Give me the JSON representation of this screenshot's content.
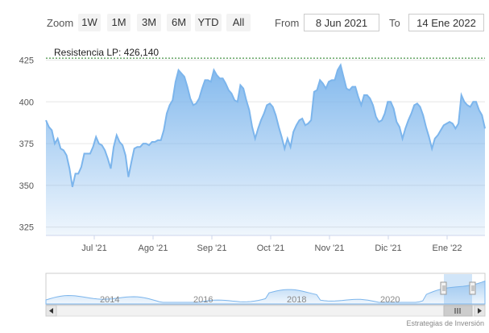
{
  "toolbar": {
    "zoom_label": "Zoom",
    "buttons": [
      "1W",
      "1M",
      "3M",
      "6M",
      "YTD",
      "All"
    ],
    "from_label": "From",
    "from_value": "8 Jun 2021",
    "to_label": "To",
    "to_value": "14 Ene 2022"
  },
  "credit": "Estrategias de Inversión",
  "navigator": {
    "years": [
      "2014",
      "2016",
      "2018",
      "2020"
    ]
  },
  "colors": {
    "line": "#7cb5ec",
    "area_top": "#7cb5ec",
    "resistance": "#1a7a1a"
  },
  "chart_data": {
    "type": "area",
    "title": "",
    "xlabel": "",
    "ylabel": "",
    "ylim": [
      320,
      432
    ],
    "yticks": [
      325,
      350,
      375,
      400,
      425
    ],
    "grid": true,
    "x_tick_labels": [
      "Jul '21",
      "Ago '21",
      "Sep '21",
      "Oct '21",
      "Nov '21",
      "Dic '21",
      "Ene '22"
    ],
    "resistance": {
      "label": "Resistencia LP: 426,140",
      "value": 426.14
    },
    "series": [
      {
        "values": [
          389,
          385,
          383,
          375,
          378,
          372,
          371,
          368,
          360,
          349,
          357,
          357,
          361,
          369,
          369,
          369,
          373,
          379,
          375,
          374,
          371,
          366,
          360,
          373,
          380,
          376,
          374,
          368,
          355,
          364,
          372,
          373,
          373,
          375,
          375,
          374,
          376,
          376,
          377,
          377,
          383,
          393,
          398,
          401,
          412,
          419,
          417,
          415,
          409,
          402,
          398,
          399,
          402,
          408,
          413,
          413,
          412,
          419,
          416,
          414,
          414,
          411,
          407,
          405,
          401,
          400,
          410,
          408,
          401,
          395,
          385,
          378,
          384,
          389,
          393,
          398,
          399,
          397,
          392,
          385,
          379,
          372,
          378,
          373,
          382,
          386,
          389,
          390,
          386,
          387,
          389,
          406,
          407,
          413,
          411,
          408,
          412,
          413,
          413,
          419,
          422,
          415,
          408,
          407,
          409,
          409,
          403,
          398,
          404,
          404,
          402,
          398,
          391,
          388,
          389,
          393,
          400,
          400,
          396,
          388,
          385,
          378,
          384,
          389,
          393,
          398,
          399,
          397,
          392,
          385,
          379,
          372,
          378,
          380,
          383,
          386,
          387,
          388,
          387,
          384,
          387,
          404,
          400,
          398,
          397,
          400,
          400,
          395,
          392,
          384
        ]
      }
    ]
  }
}
